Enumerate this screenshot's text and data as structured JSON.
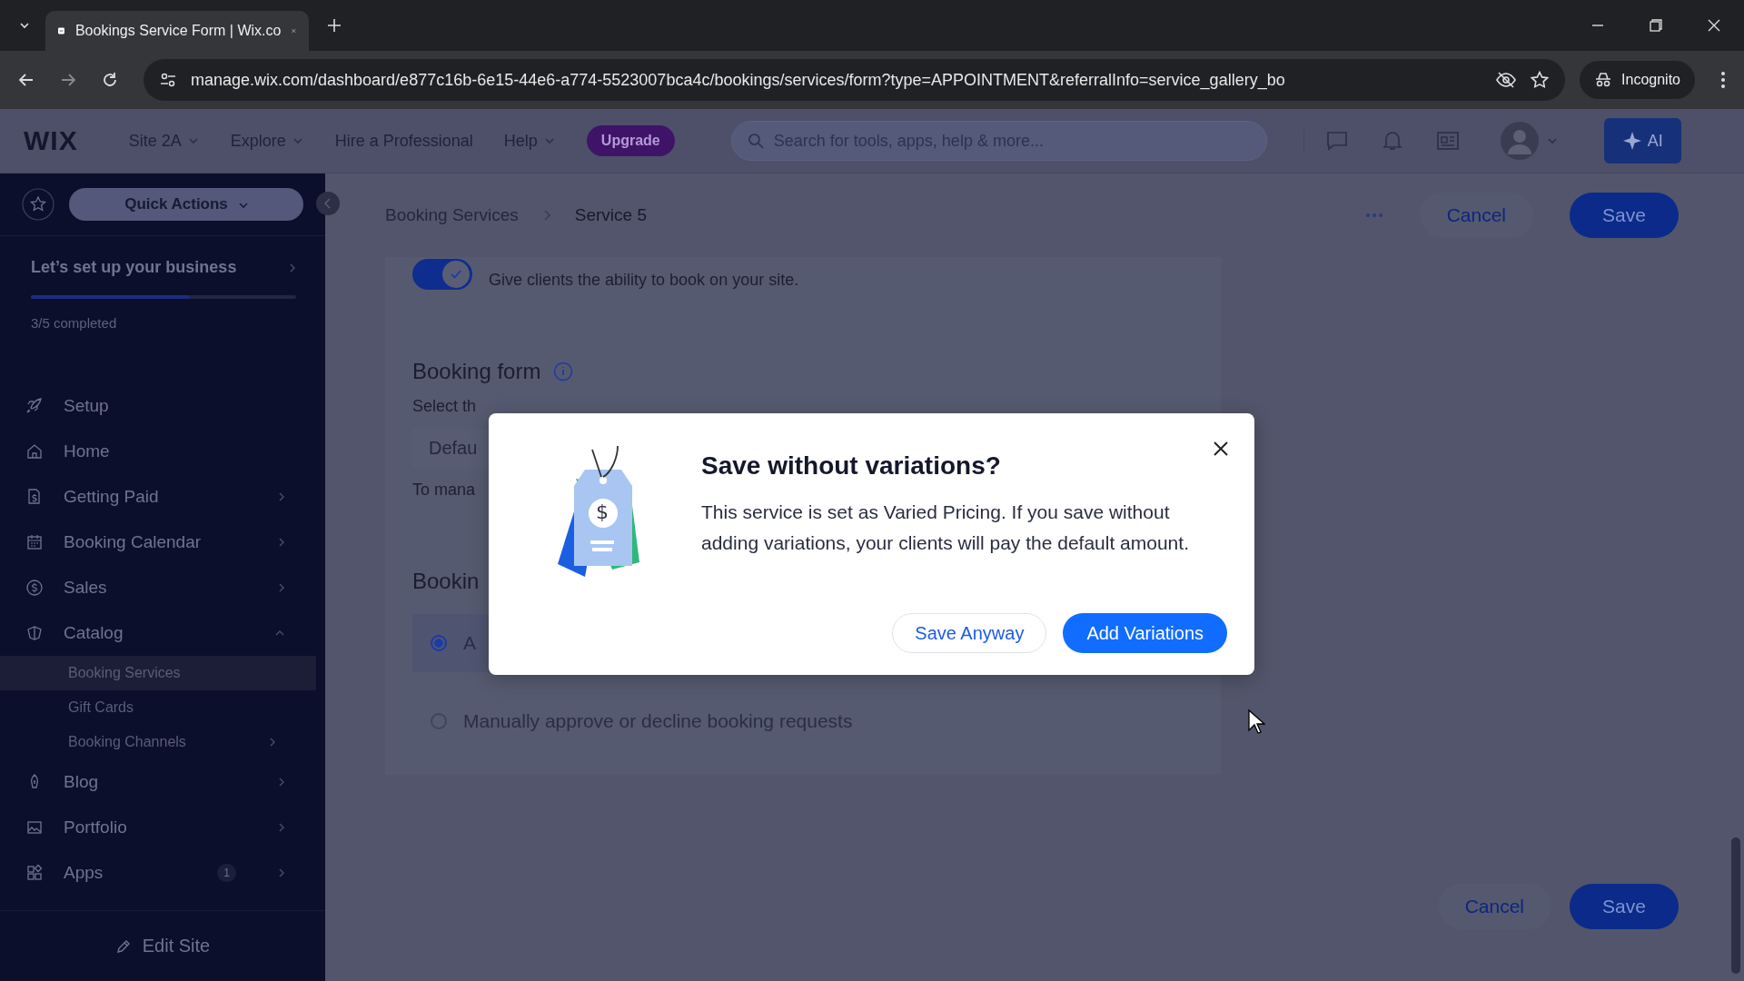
{
  "browser": {
    "tab_title": "Bookings Service Form | Wix.co",
    "url": "manage.wix.com/dashboard/e877c16b-6e15-44e6-a774-5523007bca4c/bookings/services/form?type=APPOINTMENT&referralInfo=service_gallery_bo",
    "profile": "Incognito"
  },
  "topbar": {
    "logo": "WIX",
    "menus": [
      {
        "label": "Site 2A",
        "dropdown": true
      },
      {
        "label": "Explore",
        "dropdown": true
      },
      {
        "label": "Hire a Professional",
        "dropdown": false
      },
      {
        "label": "Help",
        "dropdown": true
      }
    ],
    "upgrade": "Upgrade",
    "search_placeholder": "Search for tools, apps, help & more...",
    "ai": "AI"
  },
  "sidebar": {
    "quick_actions": "Quick Actions",
    "setup": {
      "title": "Let’s set up your business",
      "level": 0.6,
      "progress": "3/5 completed"
    },
    "items": [
      {
        "label": "Setup",
        "kind": "link"
      },
      {
        "label": "Home",
        "kind": "link"
      },
      {
        "label": "Getting Paid",
        "kind": "menu",
        "expanded": false
      },
      {
        "label": "Booking Calendar",
        "kind": "menu",
        "expanded": false
      },
      {
        "label": "Sales",
        "kind": "menu",
        "expanded": false
      },
      {
        "label": "Catalog",
        "kind": "menu",
        "expanded": true,
        "children": [
          {
            "label": "Booking Services",
            "selected": true,
            "kind": "link"
          },
          {
            "label": "Gift Cards",
            "selected": false,
            "kind": "link"
          },
          {
            "label": "Booking Channels",
            "selected": false,
            "kind": "menu"
          }
        ]
      },
      {
        "label": "Blog",
        "kind": "menu",
        "expanded": false
      },
      {
        "label": "Portfolio",
        "kind": "menu",
        "expanded": false
      },
      {
        "label": "Apps",
        "kind": "menu",
        "expanded": false,
        "badge": "1"
      }
    ],
    "edit_site": "Edit Site"
  },
  "header": {
    "breadcrumbs": [
      "Booking Services",
      "Service 5"
    ],
    "cancel": "Cancel",
    "save": "Save"
  },
  "form": {
    "online_bookings": {
      "on": true,
      "description": "Give clients the ability to book on your site."
    },
    "booking_form": {
      "title": "Booking form",
      "description": "Select th",
      "value": "Defau",
      "note": "To mana"
    },
    "approval": {
      "title": "Bookin",
      "options": [
        {
          "label": "A",
          "selected": true
        },
        {
          "label": "Manually approve or decline booking requests",
          "selected": false
        }
      ]
    }
  },
  "footer": {
    "cancel": "Cancel",
    "save": "Save"
  },
  "dialog": {
    "art_symbol": "$",
    "title": "Save without variations?",
    "body": "This service is set as Varied Pricing. If you save without adding variations, your clients will pay the default amount.",
    "secondary": "Save Anyway",
    "primary": "Add Variations"
  }
}
